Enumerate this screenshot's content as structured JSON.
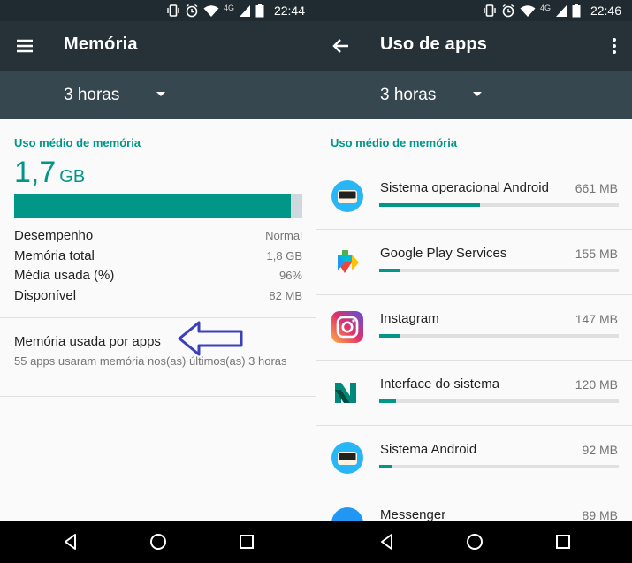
{
  "colors": {
    "teal": "#009688",
    "toolbar": "#263238",
    "spinner": "#37474f",
    "statusbar": "#1f2b30",
    "arrow": "#3b3fbf"
  },
  "left": {
    "status_time": "22:44",
    "net_label": "4G",
    "toolbar_title": "Memória",
    "nav_icon": "menu-icon",
    "period": "3 horas",
    "section_title": "Uso médio de memória",
    "avg_value": "1,7",
    "avg_unit": "GB",
    "usage_fraction": 0.96,
    "stats": [
      {
        "label": "Desempenho",
        "value": "Normal"
      },
      {
        "label": "Memória total",
        "value": "1,8 GB"
      },
      {
        "label": "Média usada (%)",
        "value": "96%"
      },
      {
        "label": "Disponível",
        "value": "82 MB"
      }
    ],
    "apps_link_title": "Memória usada por apps",
    "apps_link_subtitle": "55 apps usaram memória nos(as) últimos(as) 3 horas"
  },
  "right": {
    "status_time": "22:46",
    "net_label": "4G",
    "toolbar_title": "Uso de apps",
    "nav_icon": "back-arrow-icon",
    "period": "3 horas",
    "section_title": "Uso médio de memória",
    "apps": [
      {
        "name": "Sistema operacional Android",
        "size": "661 MB",
        "fraction": 0.42,
        "icon": "android-os-icon"
      },
      {
        "name": "Google Play Services",
        "size": "155 MB",
        "fraction": 0.09,
        "icon": "play-services-icon"
      },
      {
        "name": "Instagram",
        "size": "147 MB",
        "fraction": 0.09,
        "icon": "instagram-icon"
      },
      {
        "name": "Interface do sistema",
        "size": "120 MB",
        "fraction": 0.07,
        "icon": "system-ui-icon"
      },
      {
        "name": "Sistema Android",
        "size": "92 MB",
        "fraction": 0.05,
        "icon": "android-system-icon"
      },
      {
        "name": "Messenger",
        "size": "89 MB",
        "fraction": 0.05,
        "icon": "messenger-icon"
      }
    ]
  }
}
